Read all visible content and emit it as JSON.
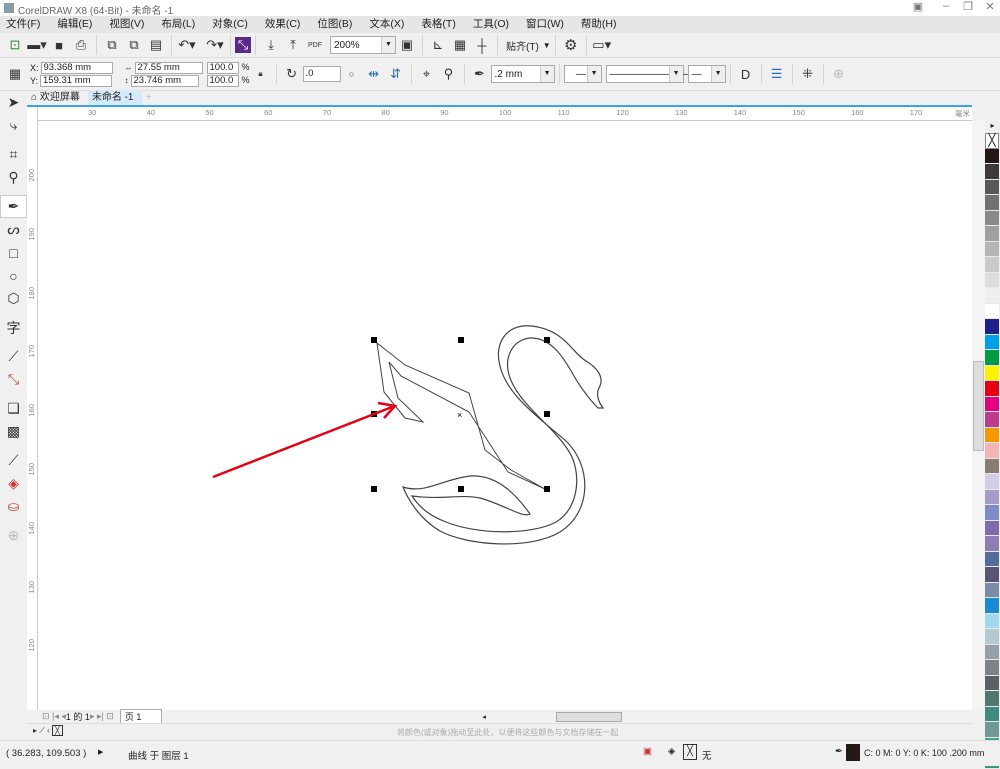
{
  "window": {
    "title": "CorelDRAW X8 (64-Bit) - 未命名 -1"
  },
  "menu": [
    "文件(F)",
    "编辑(E)",
    "视图(V)",
    "布局(L)",
    "对象(C)",
    "效果(C)",
    "位图(B)",
    "文本(X)",
    "表格(T)",
    "工具(O)",
    "窗口(W)",
    "帮助(H)"
  ],
  "toolbar": {
    "zoom": "200%",
    "snap": "贴齐(T)",
    "pdf": "PDF"
  },
  "props": {
    "x": "93.368 mm",
    "y": "159.31 mm",
    "x_label": "X:",
    "y_label": "Y:",
    "width": "27.55 mm",
    "height": "23.746 mm",
    "scale_x": "100.0",
    "scale_y": "100.0",
    "pct": "%",
    "rotation": ".0",
    "outline": ".2 mm"
  },
  "tabs": [
    {
      "label": "欢迎屏幕"
    },
    {
      "label": "未命名 -1"
    }
  ],
  "ruler": {
    "h": [
      "30",
      "40",
      "50",
      "60",
      "70",
      "80",
      "90",
      "100",
      "110",
      "120",
      "130",
      "140",
      "150",
      "160",
      "170"
    ],
    "unit": "毫米",
    "v": [
      "200",
      "190",
      "180",
      "170",
      "160",
      "150",
      "140",
      "130",
      "120"
    ]
  },
  "pagenav": {
    "page_of": "1 的 1",
    "page_tab": "页 1"
  },
  "colorbar": {
    "hint": "将颜色(或对象)拖动至此处，以便将这些颜色与文档存储在一起"
  },
  "status": {
    "coords": "( 36.283, 109.503 )",
    "object": "曲线 于 图层 1",
    "fill": "无",
    "outline_info": "C: 0 M: 0 Y: 0 K: 100  .200 mm"
  },
  "palette": [
    "#231815",
    "#3e3a39",
    "#595757",
    "#727171",
    "#898989",
    "#9fa0a0",
    "#b5b5b6",
    "#c9caca",
    "#dcdddd",
    "#efefef",
    "#ffffff",
    "#1d2088",
    "#00a0e9",
    "#009944",
    "#fff100",
    "#e60012",
    "#e4007f",
    "#be3c8c",
    "#f39800",
    "#f4b4b4",
    "#8c7b72",
    "#d3cde6",
    "#a59aca",
    "#7b8cc8",
    "#7f6aad",
    "#8e7eb4",
    "#546c9b",
    "#5a5478",
    "#7a8ca6",
    "#1a8ad4",
    "#a0d8ef",
    "#b4c8d2",
    "#96a0a8",
    "#7c8288",
    "#5a6066",
    "#4f7770",
    "#3f8a80",
    "#6f9a96",
    "#4aa38f",
    "#3a9a70"
  ],
  "colors": {
    "accent": "#3aa3e3",
    "arrow": "#e60012"
  }
}
